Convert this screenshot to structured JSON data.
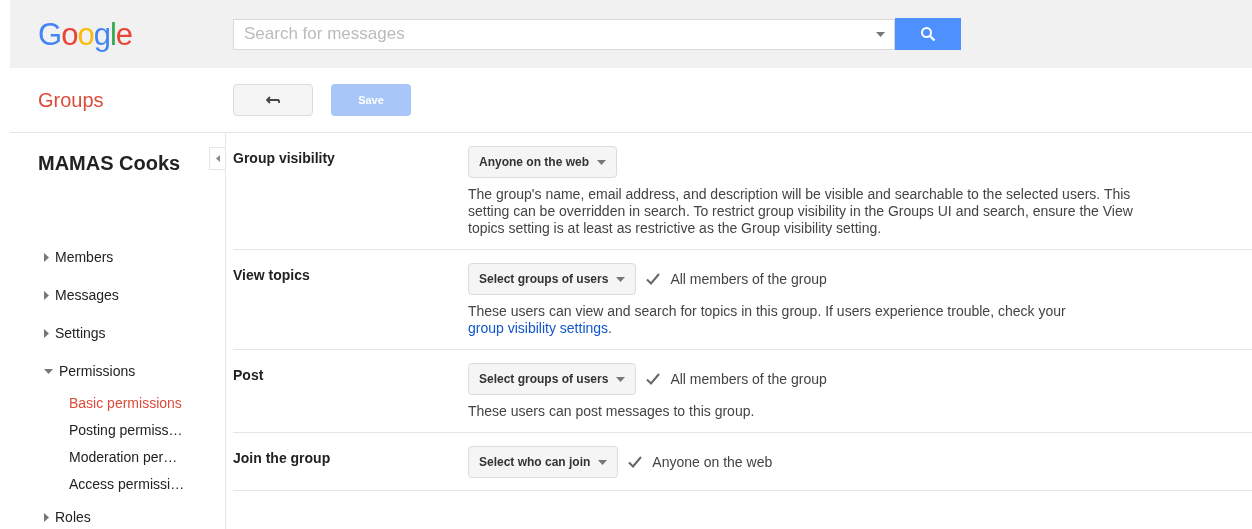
{
  "header": {
    "logo": "Google",
    "search": {
      "placeholder": "Search for messages"
    }
  },
  "toolbar": {
    "app_title": "Groups",
    "save": {
      "label": "Save",
      "disabled": true
    }
  },
  "sidebar": {
    "group_name": "MAMAS Cooks",
    "items": [
      {
        "label": "Members",
        "expanded": false
      },
      {
        "label": "Messages",
        "expanded": false
      },
      {
        "label": "Settings",
        "expanded": false
      },
      {
        "label": "Permissions",
        "expanded": true,
        "children": [
          {
            "label": "Basic permissions",
            "selected": true
          },
          {
            "label": "Posting permiss…",
            "selected": false
          },
          {
            "label": "Moderation per…",
            "selected": false
          },
          {
            "label": "Access permissi…",
            "selected": false
          }
        ]
      },
      {
        "label": "Roles",
        "expanded": false
      }
    ]
  },
  "settings": [
    {
      "label": "Group visibility",
      "dropdown": "Anyone on the web",
      "description": "The group's name, email address, and description will be visible and searchable to the selected users. This setting can be overridden in search. To restrict group visibility in the Groups UI and search, ensure the View topics setting is at least as restrictive as the Group visibility setting."
    },
    {
      "label": "View topics",
      "dropdown": "Select groups of users",
      "chosen": "All members of the group",
      "description": "These users can view and search for topics in this group. If users experience trouble, check your",
      "link": "group visibility settings",
      "link_suffix": "."
    },
    {
      "label": "Post",
      "dropdown": "Select groups of users",
      "chosen": "All members of the group",
      "description": "These users can post messages to this group."
    },
    {
      "label": "Join the group",
      "dropdown": "Select who can join",
      "chosen": "Anyone on the web"
    }
  ]
}
